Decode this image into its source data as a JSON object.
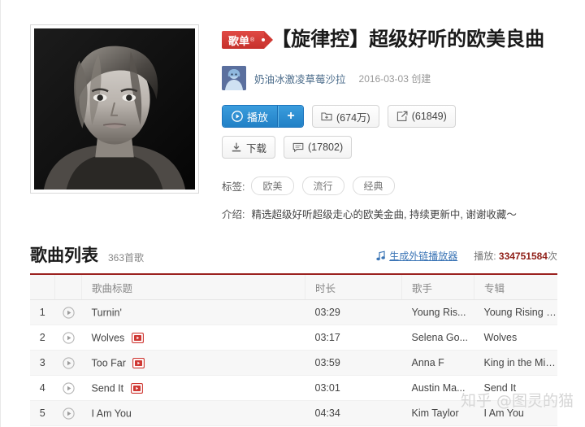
{
  "playlist": {
    "badge": "歌单",
    "badge_reg": "®",
    "title": "【旋律控】超级好听的欧美良曲",
    "author": "奶油冰激凌草莓沙拉",
    "create_date": "2016-03-03 创建",
    "cover_alt": "黑白人像专辑封面"
  },
  "actions": {
    "play_label": "播放",
    "add_label": "+",
    "collect_label": "(674万)",
    "share_label": "(61849)",
    "download_label": "下载",
    "comment_label": "(17802)",
    "icons": {
      "play": "play-circle-icon",
      "add": "plus-icon",
      "collect": "folder-add-icon",
      "share": "share-icon",
      "download": "download-icon",
      "comment": "comment-icon"
    }
  },
  "meta": {
    "tags_label": "标签:",
    "tags": [
      "欧美",
      "流行",
      "经典"
    ],
    "desc_label": "介绍:",
    "desc_text": "精选超级好听超级走心的欧美金曲, 持续更新中, 谢谢收藏～"
  },
  "song_list": {
    "section_title": "歌曲列表",
    "song_count": "363首歌",
    "ext_player_link": "生成外链播放器",
    "play_stat_label": "播放:",
    "play_stat_value": "334751584",
    "play_stat_unit": "次",
    "columns": {
      "num": "",
      "play": "",
      "title": "歌曲标题",
      "duration": "时长",
      "artist": "歌手",
      "album": "专辑"
    },
    "rows": [
      {
        "num": "1",
        "title": "Turnin'",
        "mv": false,
        "duration": "03:29",
        "artist": "Young Ris...",
        "album": "Young Rising Sons"
      },
      {
        "num": "2",
        "title": "Wolves",
        "mv": true,
        "duration": "03:17",
        "artist": "Selena Go...",
        "album": "Wolves"
      },
      {
        "num": "3",
        "title": "Too Far",
        "mv": true,
        "duration": "03:59",
        "artist": "Anna F",
        "album": "King in the Mirror"
      },
      {
        "num": "4",
        "title": "Send It",
        "mv": true,
        "duration": "03:01",
        "artist": "Austin Ma...",
        "album": "Send It"
      },
      {
        "num": "5",
        "title": "I Am You",
        "mv": false,
        "duration": "04:34",
        "artist": "Kim Taylor",
        "album": "I Am You"
      }
    ]
  },
  "watermark": "知乎 @图灵的猫",
  "colors": {
    "badge_red": "#cf3833",
    "primary_blue": "#2180c6",
    "link_blue": "#3a74b5",
    "rule_red": "#9b2220",
    "stat_red": "#8f1f18"
  }
}
